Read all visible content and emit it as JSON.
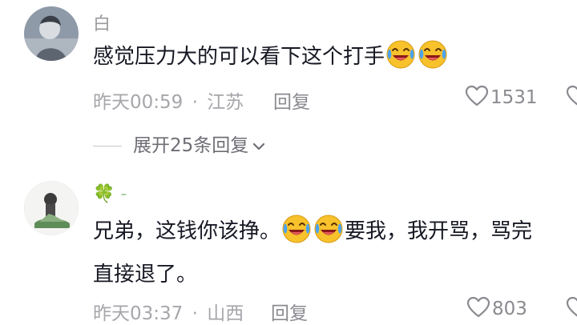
{
  "comments": [
    {
      "username": "白",
      "text": "感觉压力大的可以看下这个打手",
      "emoji_icons": [
        "laugh-cry-emoji-icon",
        "laugh-cry-emoji-icon"
      ],
      "time": "昨天00:59",
      "location": "江苏",
      "reply_label": "回复",
      "like_count": "1531"
    },
    {
      "username": "🍀 -",
      "text_part1": "兄弟，这钱你该挣。",
      "emoji_icons": [
        "laugh-cry-emoji-icon",
        "laugh-cry-emoji-icon"
      ],
      "text_part2": "要我，我开骂，骂完",
      "text_line2": "直接退了。",
      "time": "昨天03:37",
      "location": "山西",
      "reply_label": "回复",
      "like_count": "803"
    }
  ],
  "expand_replies": "展开25条回复",
  "separator": "·",
  "colors": {
    "text": "#161823",
    "meta": "#a6a6ab",
    "emoji_yellow": "#f7c22c",
    "tear_blue": "#4aa3f0"
  }
}
